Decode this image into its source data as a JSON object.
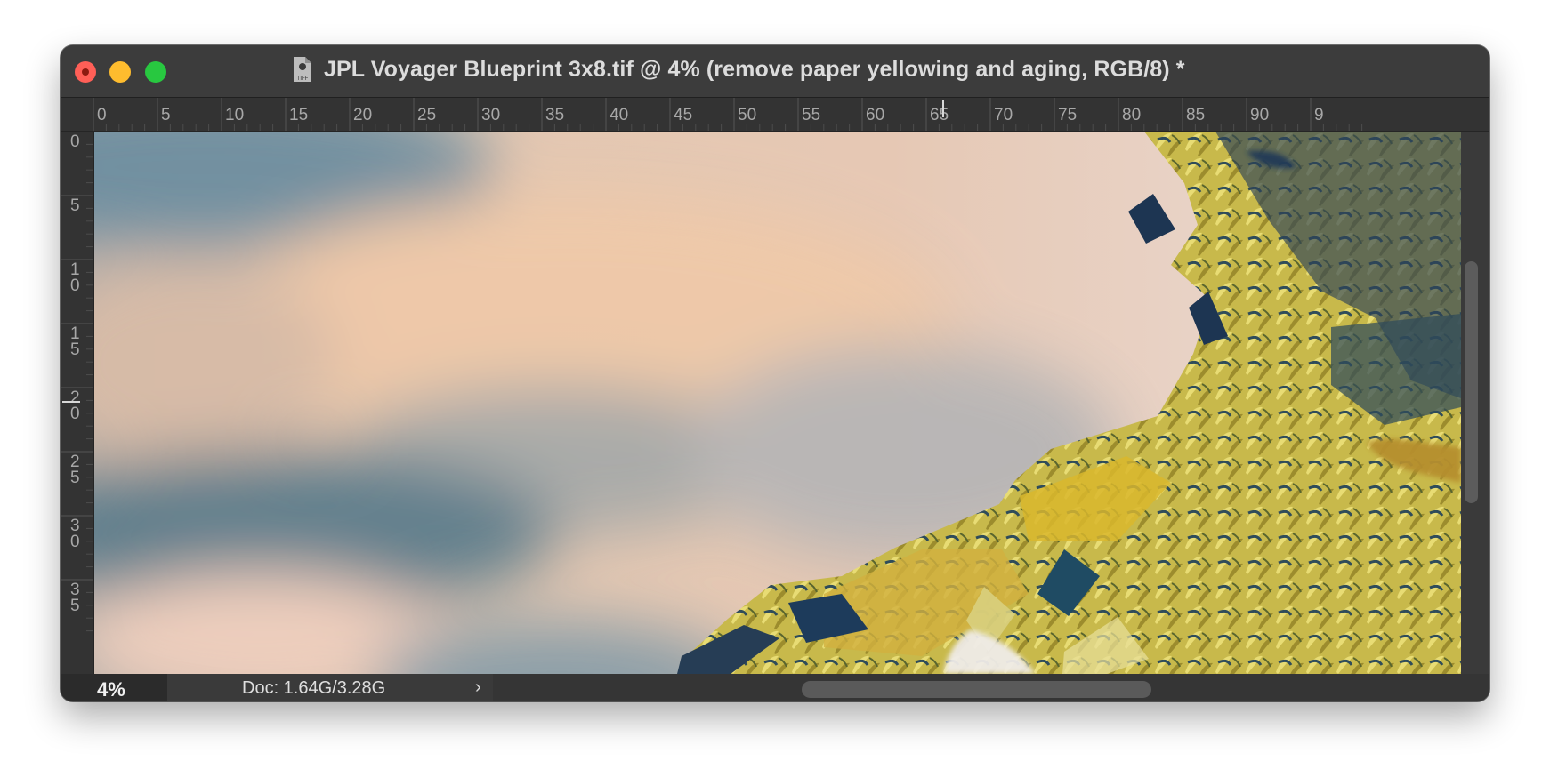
{
  "window": {
    "title": "JPL Voyager Blueprint 3x8.tif @ 4% (remove paper yellowing and aging, RGB/8) *",
    "file_icon": "tif-file-icon",
    "file_icon_label": "TIFF"
  },
  "traffic_lights": {
    "close": "#ff5f57",
    "minimize": "#febc2e",
    "maximize": "#28c840"
  },
  "rulers": {
    "horizontal_labels": [
      "0",
      "5",
      "10",
      "15",
      "20",
      "25",
      "30",
      "35",
      "40",
      "45",
      "50",
      "55",
      "60",
      "65",
      "70",
      "75",
      "80",
      "85",
      "90",
      "9"
    ],
    "vertical_labels": [
      "0",
      "5",
      "1\n0",
      "1\n5",
      "2\n0",
      "2\n5",
      "3\n0",
      "3\n5"
    ]
  },
  "status": {
    "zoom": "4%",
    "doc_info": "Doc: 1.64G/3.28G",
    "expand_arrow": "›"
  },
  "colors": {
    "window_bg": "#2f2f2f",
    "titlebar": "#3c3c3c",
    "ruler_bg": "#333333",
    "canvas_sky": "#e8c9b1",
    "canvas_blue": "#7f9aa9",
    "foliage_yellow": "#d3c24b",
    "foliage_dark": "#223b58"
  }
}
